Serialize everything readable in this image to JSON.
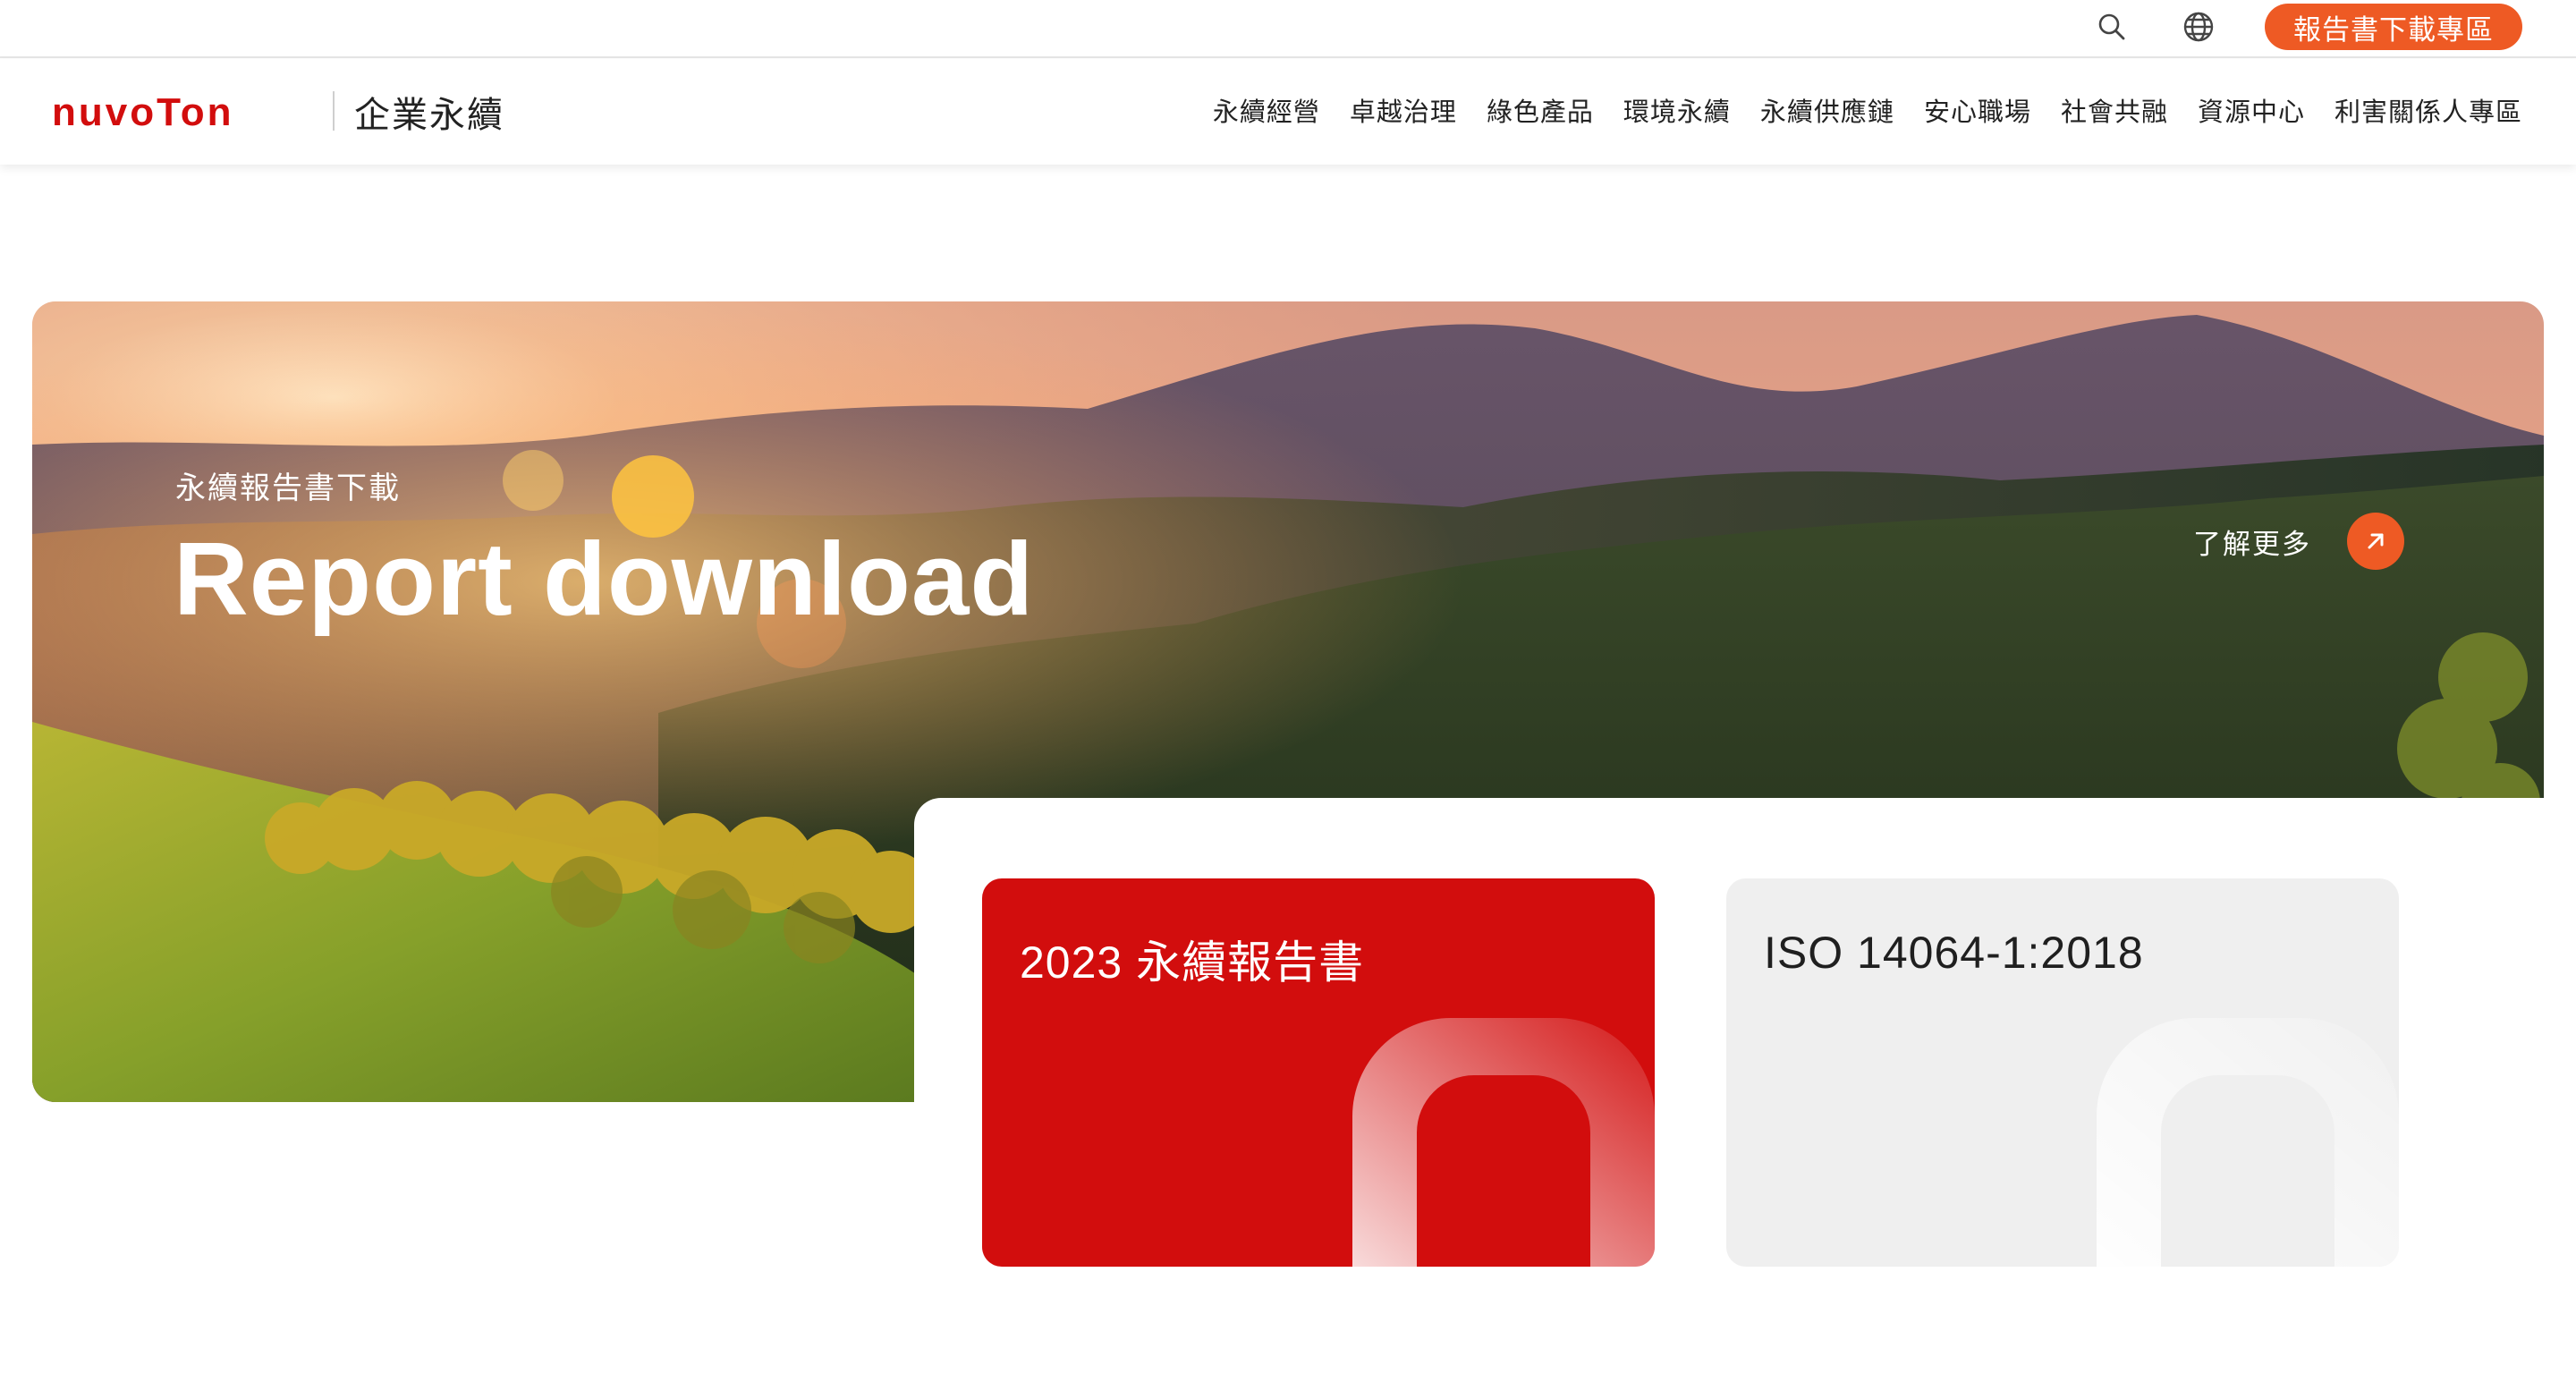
{
  "utility": {
    "search_icon": "search-icon",
    "language_icon": "globe-icon",
    "report_button_label": "報告書下載專區"
  },
  "brand": {
    "logo_text": "nuvoTon",
    "section_title": "企業永續",
    "primary_color": "#d20d0d",
    "accent_color": "#ee5a24"
  },
  "nav": {
    "items": [
      {
        "label": "永續經營"
      },
      {
        "label": "卓越治理"
      },
      {
        "label": "綠色產品"
      },
      {
        "label": "環境永續"
      },
      {
        "label": "永續供應鏈"
      },
      {
        "label": "安心職場"
      },
      {
        "label": "社會共融"
      },
      {
        "label": "資源中心"
      },
      {
        "label": "利害關係人專區"
      }
    ]
  },
  "hero": {
    "subtitle": "永續報告書下載",
    "title": "Report download",
    "learn_more_label": "了解更多",
    "learn_more_icon": "arrow-up-right-icon"
  },
  "cards": [
    {
      "title": "2023 永續報告書",
      "color": "#d20d0d"
    },
    {
      "title": "ISO 14064-1:2018",
      "color": "#efefef"
    }
  ]
}
